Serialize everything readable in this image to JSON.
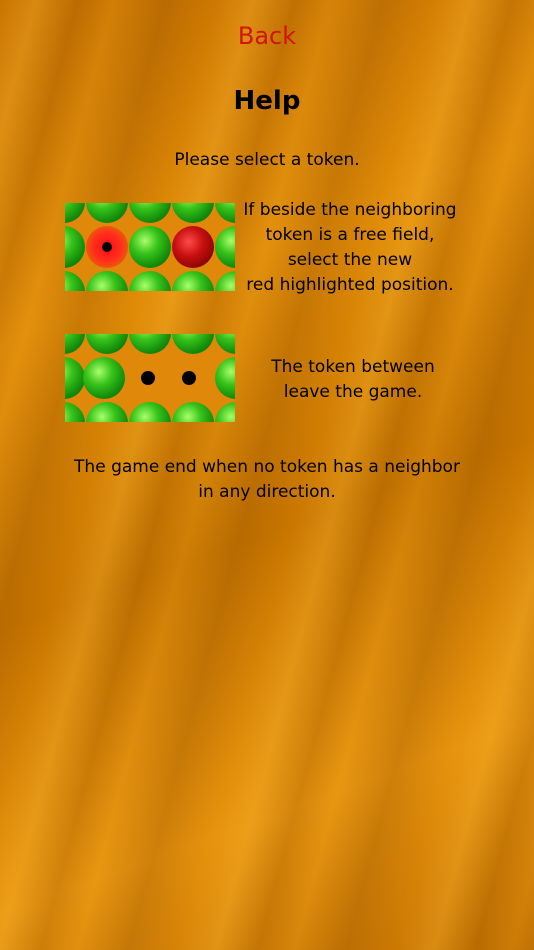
{
  "back_label": "Back",
  "title": "Help",
  "intro": "Please select a token.",
  "step1": [
    "If beside the neighboring",
    "token is a free field,",
    "select the new",
    "red highlighted position."
  ],
  "step2": [
    "The token between",
    "leave the game."
  ],
  "ending": [
    "The game end when no token has a neighbor",
    "in any direction."
  ],
  "colors": {
    "back": "#d2140a",
    "token": "#2fbf17",
    "highlight": "#ff1a1a",
    "selected": "#b80c0c"
  }
}
